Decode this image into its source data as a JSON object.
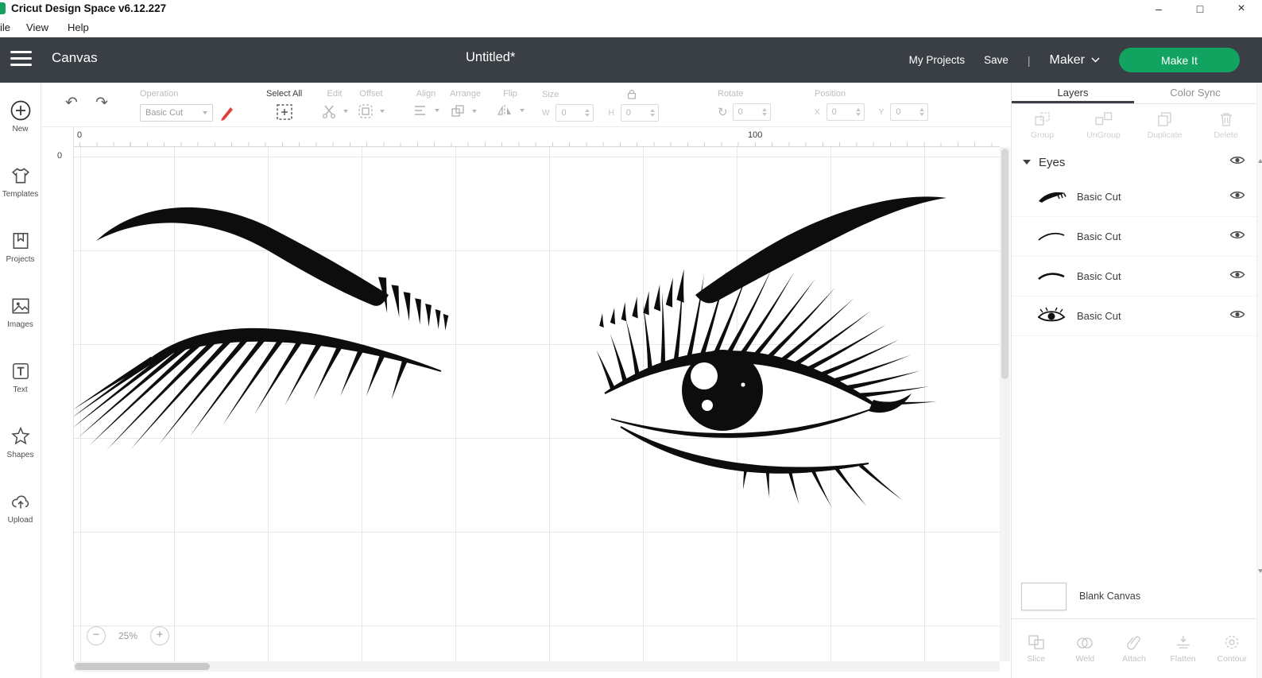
{
  "colors": {
    "brand_green": "#12a360",
    "header_bg": "#3a3f45",
    "pen_red": "#e04038"
  },
  "titlebar": {
    "title": "Cricut Design Space  v6.12.227",
    "window_controls": {
      "minimize": "–",
      "restore": "□",
      "close": "×"
    }
  },
  "menubar": {
    "items": [
      "ile",
      "View",
      "Help"
    ]
  },
  "header": {
    "menu_label": "Canvas",
    "doc_title": "Untitled*",
    "links": [
      "My Projects",
      "Save"
    ],
    "divider": "|",
    "machine": "Maker",
    "make_it": "Make It"
  },
  "sidebar": {
    "items": [
      {
        "label": "New"
      },
      {
        "label": "Templates"
      },
      {
        "label": "Projects"
      },
      {
        "label": "Images"
      },
      {
        "label": "Text"
      },
      {
        "label": "Shapes"
      },
      {
        "label": "Upload"
      }
    ]
  },
  "toolbar": {
    "operation": {
      "label": "Operation",
      "value": "Basic Cut"
    },
    "select_all": "Select All",
    "edit": "Edit",
    "offset": "Offset",
    "align": "Align",
    "arrange": "Arrange",
    "flip": "Flip",
    "size": {
      "label": "Size",
      "w": "W",
      "w_value": "0",
      "h": "H",
      "h_value": "0"
    },
    "rotate": {
      "label": "Rotate",
      "value": "0"
    },
    "position": {
      "label": "Position",
      "x": "X",
      "x_value": "0",
      "y": "Y",
      "y_value": "0"
    }
  },
  "canvas": {
    "ruler_zero": "0",
    "ruler_hundred": "100",
    "vruler_zero": "0",
    "zoom_level": "25%"
  },
  "layers_panel": {
    "tabs": {
      "layers": "Layers",
      "color_sync": "Color Sync"
    },
    "actions": [
      {
        "label": "Group"
      },
      {
        "label": "UnGroup"
      },
      {
        "label": "Duplicate"
      },
      {
        "label": "Delete"
      }
    ],
    "group": {
      "name": "Eyes"
    },
    "layers": [
      {
        "label": "Basic Cut"
      },
      {
        "label": "Basic Cut"
      },
      {
        "label": "Basic Cut"
      },
      {
        "label": "Basic Cut"
      }
    ],
    "blank_canvas": "Blank Canvas",
    "bottom_actions": [
      {
        "label": "Slice"
      },
      {
        "label": "Weld"
      },
      {
        "label": "Attach"
      },
      {
        "label": "Flatten"
      },
      {
        "label": "Contour"
      }
    ]
  }
}
